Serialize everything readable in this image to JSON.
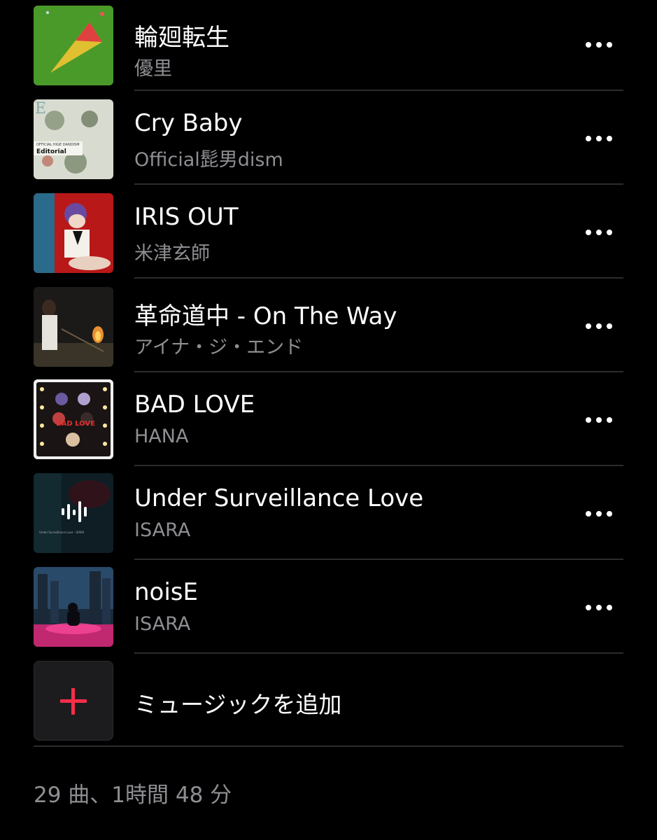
{
  "tracks": [
    {
      "title": "輪廻転生",
      "artist": "優里",
      "art_icon": "album-art-rinne-tensei"
    },
    {
      "title": "Cry Baby",
      "artist": "Official髭男dism",
      "art_icon": "album-art-editorial",
      "art_text": "Editorial"
    },
    {
      "title": "IRIS OUT",
      "artist": "米津玄師",
      "art_icon": "album-art-iris-out"
    },
    {
      "title": "革命道中 - On The Way",
      "artist": "アイナ・ジ・エンド",
      "art_icon": "album-art-kakumei-douchuu"
    },
    {
      "title": "BAD LOVE",
      "artist": "HANA",
      "art_icon": "album-art-bad-love"
    },
    {
      "title": "Under Surveillance Love",
      "artist": "ISARA",
      "art_icon": "album-art-under-surveillance-love"
    },
    {
      "title": "noisE",
      "artist": "ISARA",
      "art_icon": "album-art-noise"
    }
  ],
  "add_music": {
    "label": "ミュージックを追加",
    "icon": "plus-icon"
  },
  "summary": "29 曲、1時間 48 分",
  "colors": {
    "background": "#000000",
    "secondary_text": "#8e8e93",
    "accent": "#fa2d48",
    "divider": "#2c2c2e"
  }
}
